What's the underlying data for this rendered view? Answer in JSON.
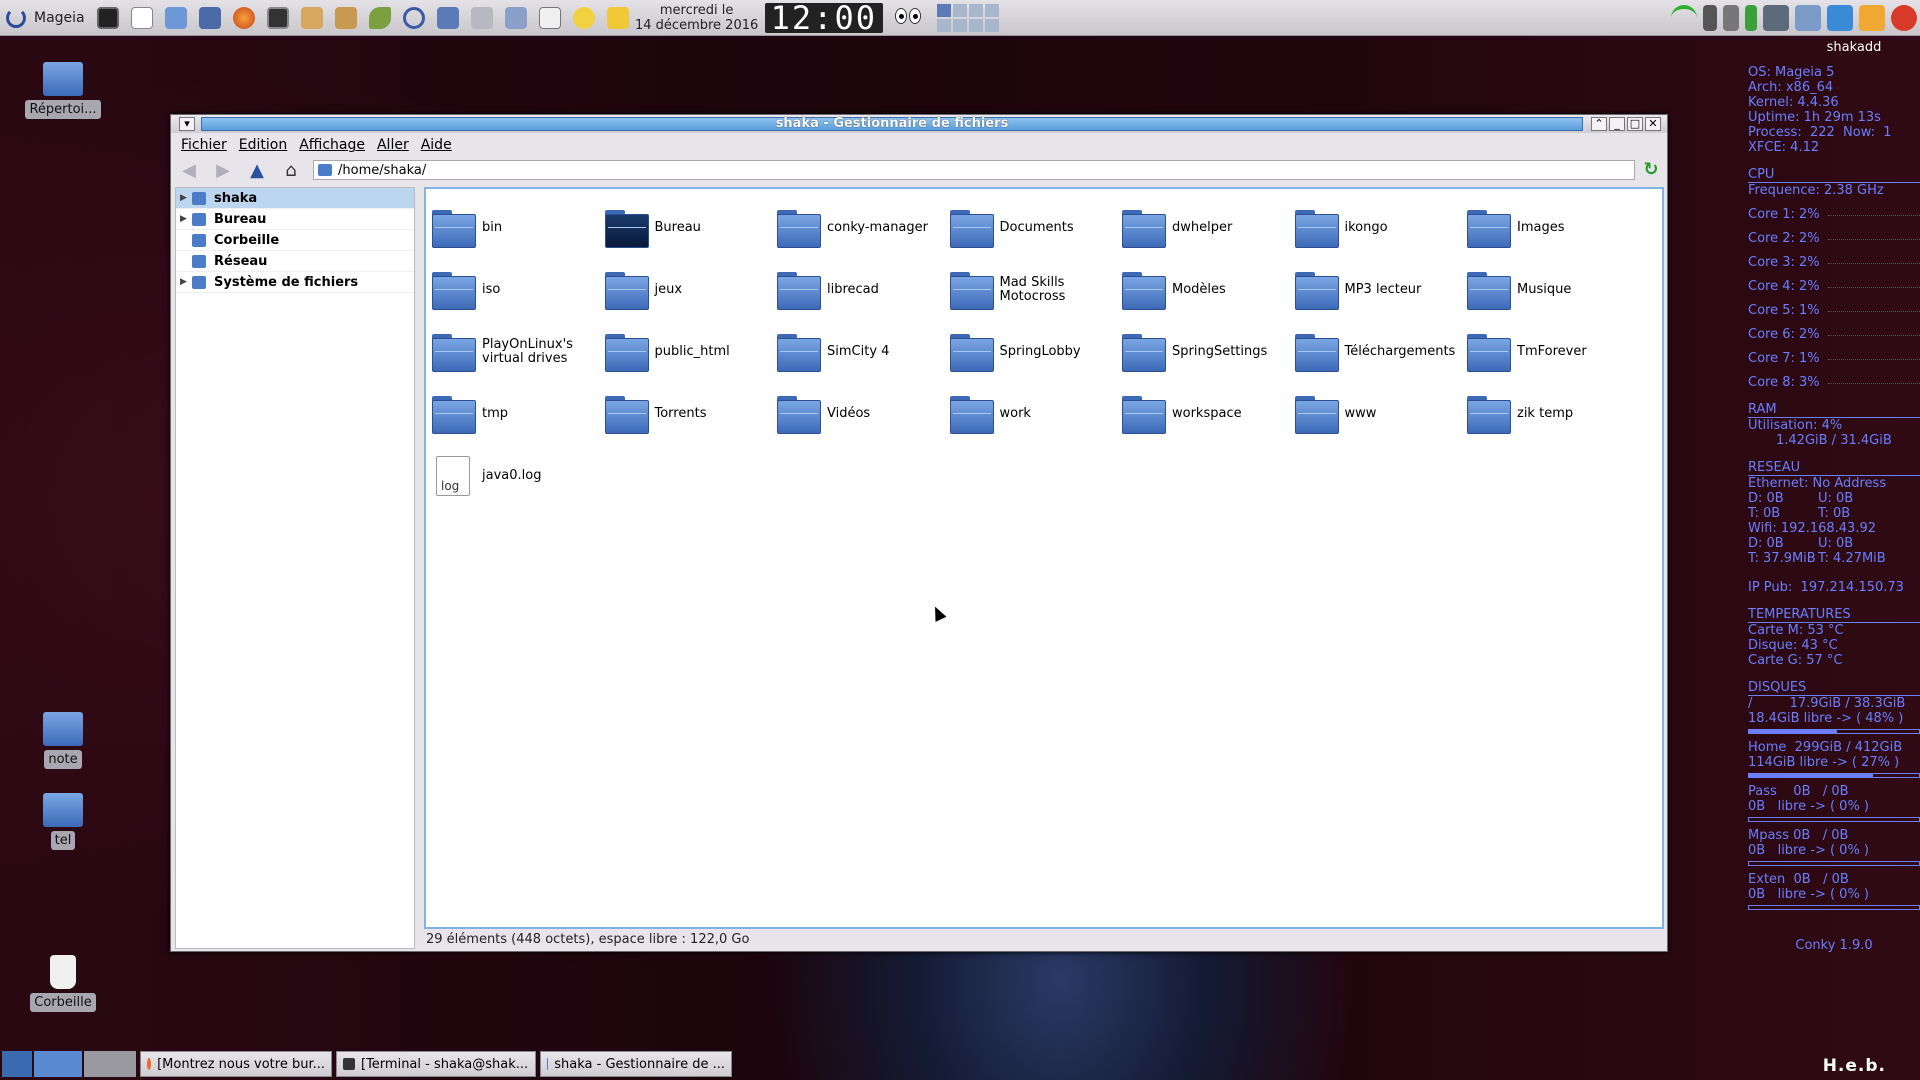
{
  "top_panel": {
    "menu_label": "Mageia",
    "date_line1": "mercredi le",
    "date_line2": "14 décembre 2016",
    "clock": "12:00",
    "launchers": [
      "terminal-icon",
      "text-editor-icon",
      "file-manager-icon",
      "floppy-save-icon",
      "firefox-icon",
      "monitor-icon",
      "people-icon",
      "package-icon",
      "leaf-icon",
      "moon-icon",
      "tools-icon",
      "hand-icon",
      "calculator-icon",
      "camera-icon",
      "yellow-circle-icon",
      "folder-yellow-icon"
    ],
    "tray_icons": [
      "wifi-icon",
      "lock-icon",
      "volume-icon",
      "battery-icon",
      "network-icon",
      "screen-icon",
      "download-icon",
      "user-icon",
      "power-icon"
    ]
  },
  "desktop": {
    "icons": [
      {
        "label": "Répertoi...",
        "icon": "home-folder-icon"
      },
      {
        "label": "note",
        "icon": "folder-icon"
      },
      {
        "label": "tel",
        "icon": "folder-icon"
      },
      {
        "label": "Corbeille",
        "icon": "trash-icon"
      }
    ]
  },
  "conky": {
    "user": "shakadd",
    "os": "OS: Mageia 5",
    "arch": "Arch: x86_64",
    "kernel": "Kernel: 4.4.36",
    "uptime": "Uptime: 1h 29m 13s",
    "process": "Process:  222  Now:  1",
    "xfce": "XFCE: 4.12",
    "cpu_header": "CPU",
    "frequence": "Frequence: 2.38 GHz",
    "cores": [
      "Core 1: 2%",
      "Core 2: 2%",
      "Core 3: 2%",
      "Core 4: 2%",
      "Core 5: 1%",
      "Core 6: 2%",
      "Core 7: 1%",
      "Core 8: 3%"
    ],
    "ram_header": "RAM",
    "ram_util": "Utilisation: 4%",
    "ram_total": "1.42GiB / 31.4GiB",
    "net_header": "RESEAU",
    "ethernet": "Ethernet: No Address",
    "eth_d": "D: 0B",
    "eth_u": "U: 0B",
    "eth_t1": "T: 0B",
    "eth_t2": "T: 0B",
    "wifi": "Wifi: 192.168.43.92",
    "wifi_d": "D: 0B",
    "wifi_u": "U: 0B",
    "wifi_t1": "T: 37.9MiB",
    "wifi_t2": "T: 4.27MiB",
    "ip_pub": "IP Pub:  197.214.150.73",
    "temp_header": "TEMPERATURES",
    "temp_m": "Carte M: 53 °C",
    "temp_d": "Disque: 43 °C",
    "temp_g": "Carte G: 57 °C",
    "disk_header": "DISQUES",
    "disks": [
      {
        "line1": "/         17.9GiB / 38.3GiB",
        "line2": "18.4GiB libre -> ( 48% )",
        "used": 0.52
      },
      {
        "line1": "Home  299GiB / 412GiB",
        "line2": "114GiB libre -> ( 27% )",
        "used": 0.73
      },
      {
        "line1": "Pass    0B   / 0B",
        "line2": "0B   libre -> ( 0% )",
        "used": 0
      },
      {
        "line1": "Mpass 0B   / 0B",
        "line2": "0B   libre -> ( 0% )",
        "used": 0
      },
      {
        "line1": "Exten  0B   / 0B",
        "line2": "0B   libre -> ( 0% )",
        "used": 0
      }
    ],
    "version": "Conky 1.9.0"
  },
  "window": {
    "title": "shaka - Gestionnaire de fichiers",
    "menu": [
      "Fichier",
      "Edition",
      "Affichage",
      "Aller",
      "Aide"
    ],
    "path": "/home/shaka/",
    "sidebar": [
      {
        "label": "shaka",
        "selected": true,
        "expander": true
      },
      {
        "label": "Bureau",
        "selected": false,
        "expander": true
      },
      {
        "label": "Corbeille",
        "selected": false,
        "expander": false
      },
      {
        "label": "Réseau",
        "selected": false,
        "expander": false
      },
      {
        "label": "Système de fichiers",
        "selected": false,
        "expander": true
      }
    ],
    "items": [
      {
        "name": "bin",
        "type": "folder"
      },
      {
        "name": "Bureau",
        "type": "desktop"
      },
      {
        "name": "conky-manager",
        "type": "folder"
      },
      {
        "name": "Documents",
        "type": "folder"
      },
      {
        "name": "dwhelper",
        "type": "folder"
      },
      {
        "name": "ikongo",
        "type": "folder"
      },
      {
        "name": "Images",
        "type": "folder"
      },
      {
        "name": "iso",
        "type": "folder"
      },
      {
        "name": "jeux",
        "type": "folder"
      },
      {
        "name": "librecad",
        "type": "folder"
      },
      {
        "name": "Mad Skills Motocross",
        "type": "folder"
      },
      {
        "name": "Modèles",
        "type": "folder"
      },
      {
        "name": "MP3 lecteur",
        "type": "folder"
      },
      {
        "name": "Musique",
        "type": "folder"
      },
      {
        "name": "PlayOnLinux's virtual drives",
        "type": "folder"
      },
      {
        "name": "public_html",
        "type": "folder"
      },
      {
        "name": "SimCity 4",
        "type": "folder"
      },
      {
        "name": "SpringLobby",
        "type": "folder"
      },
      {
        "name": "SpringSettings",
        "type": "folder"
      },
      {
        "name": "Téléchargements",
        "type": "folder"
      },
      {
        "name": "TmForever",
        "type": "folder"
      },
      {
        "name": "tmp",
        "type": "folder"
      },
      {
        "name": "Torrents",
        "type": "folder"
      },
      {
        "name": "Vidéos",
        "type": "folder"
      },
      {
        "name": "work",
        "type": "folder"
      },
      {
        "name": "workspace",
        "type": "folder"
      },
      {
        "name": "www",
        "type": "folder"
      },
      {
        "name": "zik temp",
        "type": "folder"
      },
      {
        "name": "java0.log",
        "type": "file",
        "file_glyph": "log"
      }
    ],
    "status": "29 éléments (448 octets), espace libre : 122,0 Go"
  },
  "taskbar": {
    "tasks": [
      "[Montrez nous votre bur...",
      "[Terminal - shaka@shak...",
      "shaka - Gestionnaire de ..."
    ]
  },
  "watermark": "H.e.b."
}
